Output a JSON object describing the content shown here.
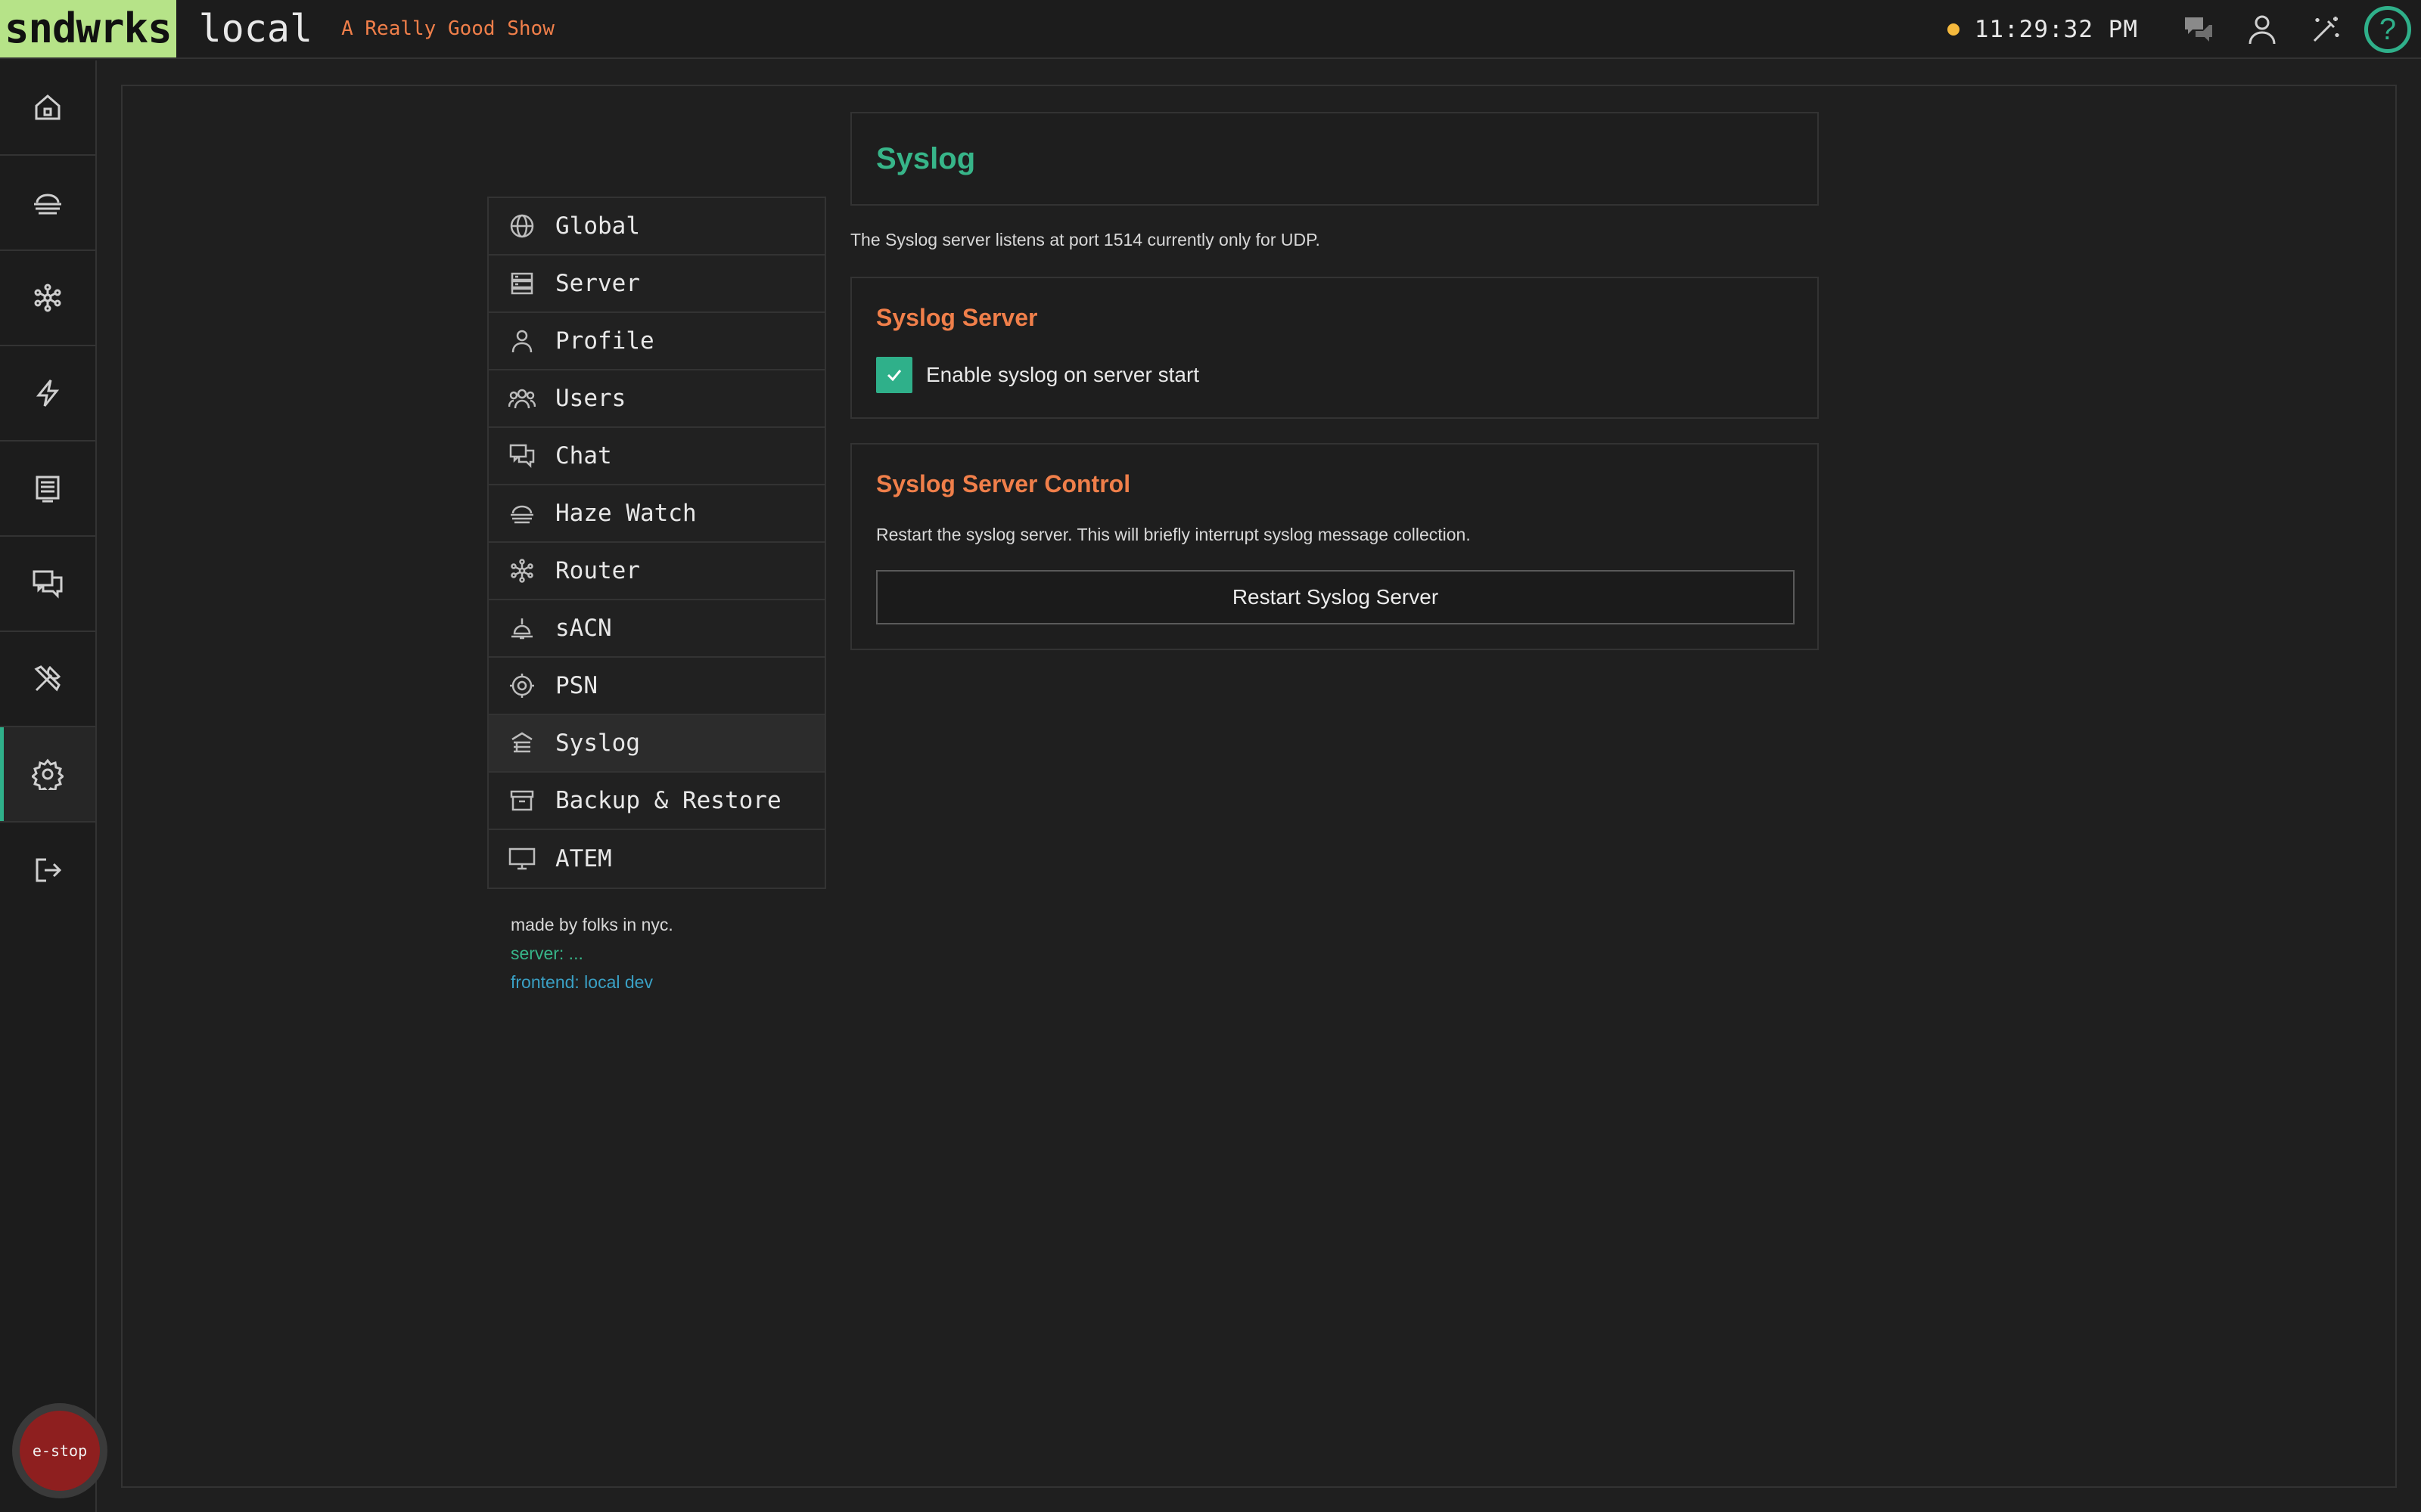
{
  "topbar": {
    "brand": "sndwrks",
    "workspace": "local",
    "show_name": "A Really Good Show",
    "clock": "11:29:32 PM",
    "status_color": "#f5b93d",
    "help_label": "?",
    "icons": [
      "chat-bubbles-icon",
      "user-icon",
      "magic-wand-icon",
      "help-icon"
    ]
  },
  "rail": {
    "items": [
      "home-icon",
      "haze-icon",
      "router-icon",
      "lightning-icon",
      "display-icon",
      "chat-icon",
      "tools-icon",
      "settings-icon",
      "logout-icon"
    ],
    "active": "settings-icon",
    "estop_label": "e-stop"
  },
  "settings_nav": {
    "items": [
      {
        "label": "Global",
        "icon": "globe-icon"
      },
      {
        "label": "Server",
        "icon": "server-icon"
      },
      {
        "label": "Profile",
        "icon": "person-icon"
      },
      {
        "label": "Users",
        "icon": "users-icon"
      },
      {
        "label": "Chat",
        "icon": "chat-icon"
      },
      {
        "label": "Haze Watch",
        "icon": "haze-icon"
      },
      {
        "label": "Router",
        "icon": "router-icon"
      },
      {
        "label": "sACN",
        "icon": "lamp-icon"
      },
      {
        "label": "PSN",
        "icon": "target-icon"
      },
      {
        "label": "Syslog",
        "icon": "syslog-icon"
      },
      {
        "label": "Backup & Restore",
        "icon": "archive-icon"
      },
      {
        "label": "ATEM",
        "icon": "monitor-icon"
      }
    ],
    "active": "Syslog"
  },
  "footer": {
    "made_by": "made by folks in nyc.",
    "server": "server: ...",
    "frontend": "frontend: local dev"
  },
  "syslog": {
    "title": "Syslog",
    "description": "The Syslog server listens at port 1514 currently only for UDP.",
    "server_section": {
      "title": "Syslog Server",
      "checkbox_label": "Enable syslog on server start",
      "checked": true
    },
    "control_section": {
      "title": "Syslog Server Control",
      "description": "Restart the syslog server. This will briefly interrupt syslog message collection.",
      "button_label": "Restart Syslog Server"
    }
  },
  "colors": {
    "accent": "#2fb08a",
    "brand_bg": "#b6e388",
    "section_title": "#f07f4a",
    "estop": "#8e1f1f"
  }
}
